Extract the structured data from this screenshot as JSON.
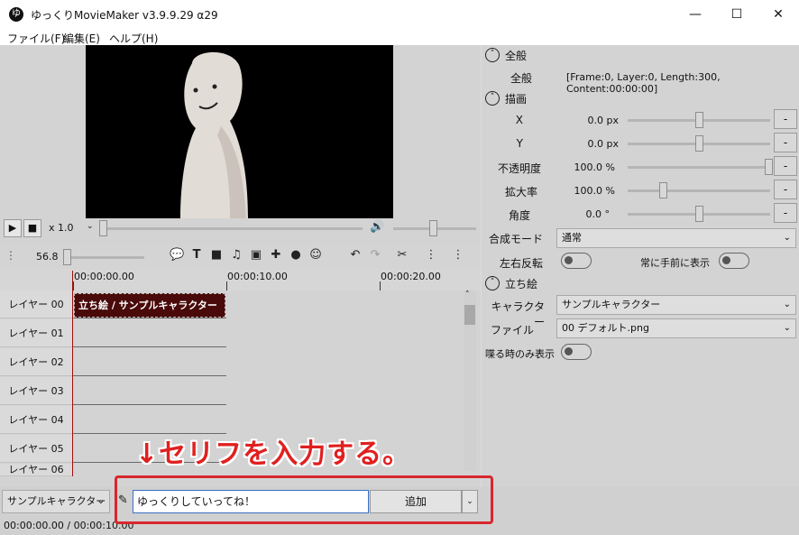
{
  "window": {
    "title": "ゆっくりMovieMaker v3.9.9.29 α29",
    "app_icon": "ゆ",
    "minimize": "—",
    "maximize": "☐",
    "close": "✕"
  },
  "menu": [
    "ファイル(F)",
    "編集(E)",
    "ヘルプ(H)"
  ],
  "player": {
    "play": "▶",
    "stop": "■",
    "speed": "x 1.0",
    "volume_icon": "speaker-icon"
  },
  "timeline": {
    "zoom": "56.8",
    "ruler": [
      "00:00:00.00",
      "00:00:10.00",
      "00:00:20.00"
    ],
    "layers": [
      "レイヤー 00",
      "レイヤー 01",
      "レイヤー 02",
      "レイヤー 03",
      "レイヤー 04",
      "レイヤー 05",
      "レイヤー 06"
    ],
    "clip_label": "立ち絵 / サンプルキャラクター"
  },
  "properties": {
    "general": {
      "header": "全般",
      "label": "全般",
      "value": "[Frame:0, Layer:0, Length:300, Content:00:00:00]"
    },
    "draw": {
      "header": "描画",
      "rows": [
        {
          "label": "X",
          "value": "0.0 px",
          "level": 0.5
        },
        {
          "label": "Y",
          "value": "0.0 px",
          "level": 0.5
        },
        {
          "label": "不透明度",
          "value": "100.0 %",
          "level": 1.0
        },
        {
          "label": "拡大率",
          "value": "100.0 %",
          "level": 0.25
        },
        {
          "label": "角度",
          "value": "0.0 °",
          "level": 0.5
        }
      ],
      "blend_label": "合成モード",
      "blend_value": "通常",
      "flip_label": "左右反転",
      "front_label": "常に手前に表示"
    },
    "standing": {
      "header": "立ち絵",
      "character_label": "キャラクター",
      "character_value": "サンプルキャラクター",
      "file_label": "ファイル",
      "file_value": "00 デフォルト.png",
      "speak_label": "喋る時のみ表示"
    }
  },
  "input": {
    "character": "サンプルキャラクター",
    "text": "ゆっくりしていってね！",
    "add": "追加"
  },
  "status": {
    "time": "00:00:00.00  /  00:00:10.00"
  },
  "annotation": "↓セリフを入力する。",
  "colors": {
    "highlight": "#d8272e",
    "clip": "#4a0a0a",
    "playhead": "#a01010"
  }
}
